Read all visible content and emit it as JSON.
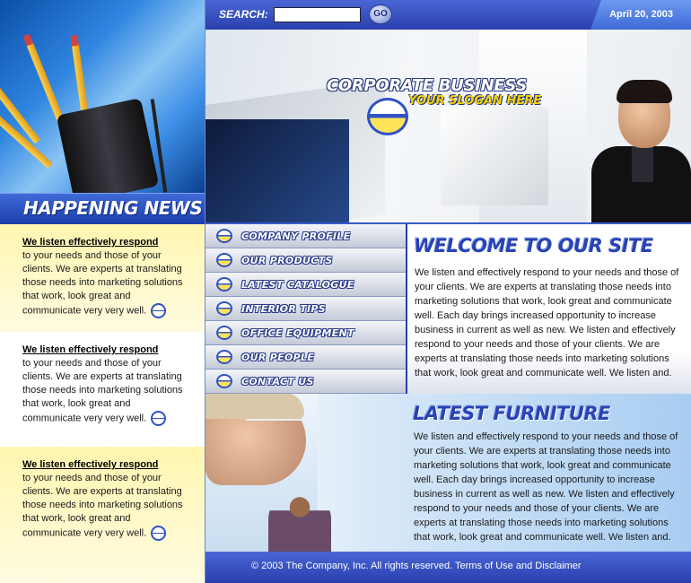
{
  "search": {
    "label": "SEARCH:",
    "placeholder": "",
    "go_label": "GO"
  },
  "date": "April 20, 2003",
  "hero": {
    "title": "CORPORATE BUSINESS",
    "slogan": "YOUR SLOGAN HERE"
  },
  "news": {
    "header": "HAPPENING NEWS",
    "items": [
      {
        "title": "We listen effectively respond",
        "text": "to your needs and those of your clients. We are experts at translating those needs into marketing solutions that work, look great and communicate very very well."
      },
      {
        "title": "We listen effectively respond",
        "text": "to your needs and those of your clients. We are experts at translating those needs into marketing solutions that work, look great and communicate very very well."
      },
      {
        "title": "We listen effectively respond",
        "text": "to your needs and those of your clients. We are experts at translating those needs into marketing solutions that work, look great and communicate very very well."
      }
    ]
  },
  "menu": [
    {
      "label": "COMPANY PROFILE"
    },
    {
      "label": "OUR PRODUCTS"
    },
    {
      "label": "LATEST CATALOGUE"
    },
    {
      "label": "INTERIOR TIPS"
    },
    {
      "label": "OFFICE EQUIPMENT"
    },
    {
      "label": "OUR PEOPLE"
    },
    {
      "label": "CONTACT US"
    }
  ],
  "welcome": {
    "title": "WELCOME TO OUR SITE",
    "text": "We listen and effectively respond to your needs and those of your clients. We are experts at translating those needs into marketing solutions that work, look great and communicate well. Each day brings increased opportunity to increase business in current as well as new.  We listen and effectively respond to your needs and those of your clients. We are experts at translating those needs into marketing solutions that work, look great and communicate well.  We listen and."
  },
  "furniture": {
    "title": "LATEST FURNITURE",
    "text": "We listen and effectively respond to your needs and those of your clients. We are experts at translating those needs into marketing solutions that work, look great and communicate well. Each day brings increased opportunity to increase business in current as well as new.  We listen and effectively respond to your needs and those of your clients. We are experts at translating those needs into marketing solutions that work, look great and communicate well.  We listen and."
  },
  "footer": "© 2003 The Company, Inc. All rights reserved. Terms of Use and Disclaimer",
  "colors": {
    "primary_blue": "#2a3fae",
    "accent_yellow": "#ffe35a",
    "title_blue": "#2843b4"
  }
}
